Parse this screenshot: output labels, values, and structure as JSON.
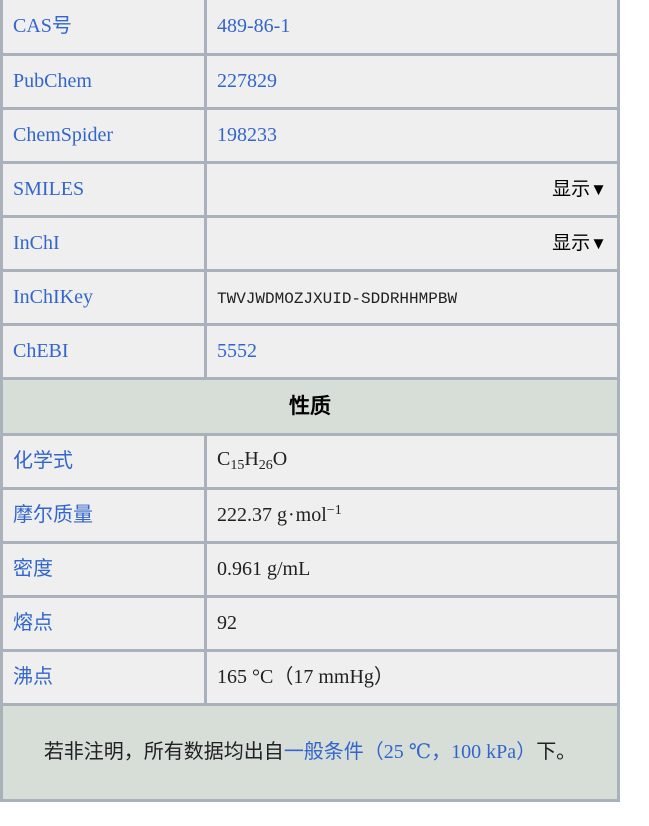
{
  "infobox": {
    "identifier_rows": [
      {
        "label": "CAS号",
        "value": "489-86-1",
        "value_is_link": true,
        "kind": "text"
      },
      {
        "label": "PubChem",
        "value": "227829",
        "value_is_link": true,
        "kind": "text"
      },
      {
        "label": "ChemSpider",
        "value": "198233",
        "value_is_link": true,
        "kind": "text"
      },
      {
        "label": "SMILES",
        "value": "显示",
        "value_is_link": false,
        "kind": "collapsed"
      },
      {
        "label": "InChI",
        "value": "显示",
        "value_is_link": false,
        "kind": "collapsed"
      },
      {
        "label": "InChIKey",
        "value": "TWVJWDMOZJXUID-SDDRHHMPBW",
        "value_is_link": false,
        "kind": "mono"
      },
      {
        "label": "ChEBI",
        "value": "5552",
        "value_is_link": true,
        "kind": "text"
      }
    ],
    "section_header": "性质",
    "property_rows": [
      {
        "label": "化学式",
        "kind": "formula",
        "formula_parts": [
          "C",
          "15",
          "H",
          "26",
          "O"
        ]
      },
      {
        "label": "摩尔质量",
        "kind": "molar_mass",
        "number": "222.37",
        "unit_g": "g",
        "sep": "·",
        "unit_mol": "mol",
        "exponent": "−1"
      },
      {
        "label": "密度",
        "kind": "text",
        "value": "0.961 g/mL"
      },
      {
        "label": "熔点",
        "kind": "text",
        "value": "92"
      },
      {
        "label": "沸点",
        "kind": "text",
        "value": "165 °C（17 mmHg）"
      }
    ],
    "footnote": {
      "lead": "若非注明，所有数据均出自",
      "link": "一般条件（25 ℃，100 kPa）",
      "tail": "下。"
    },
    "caret_glyph": "▼",
    "colors": {
      "link": "#3366cc",
      "cell_background": "#efefef",
      "header_background": "#d7ddd7",
      "border": "#a9b1ba",
      "text": "#202122"
    }
  }
}
